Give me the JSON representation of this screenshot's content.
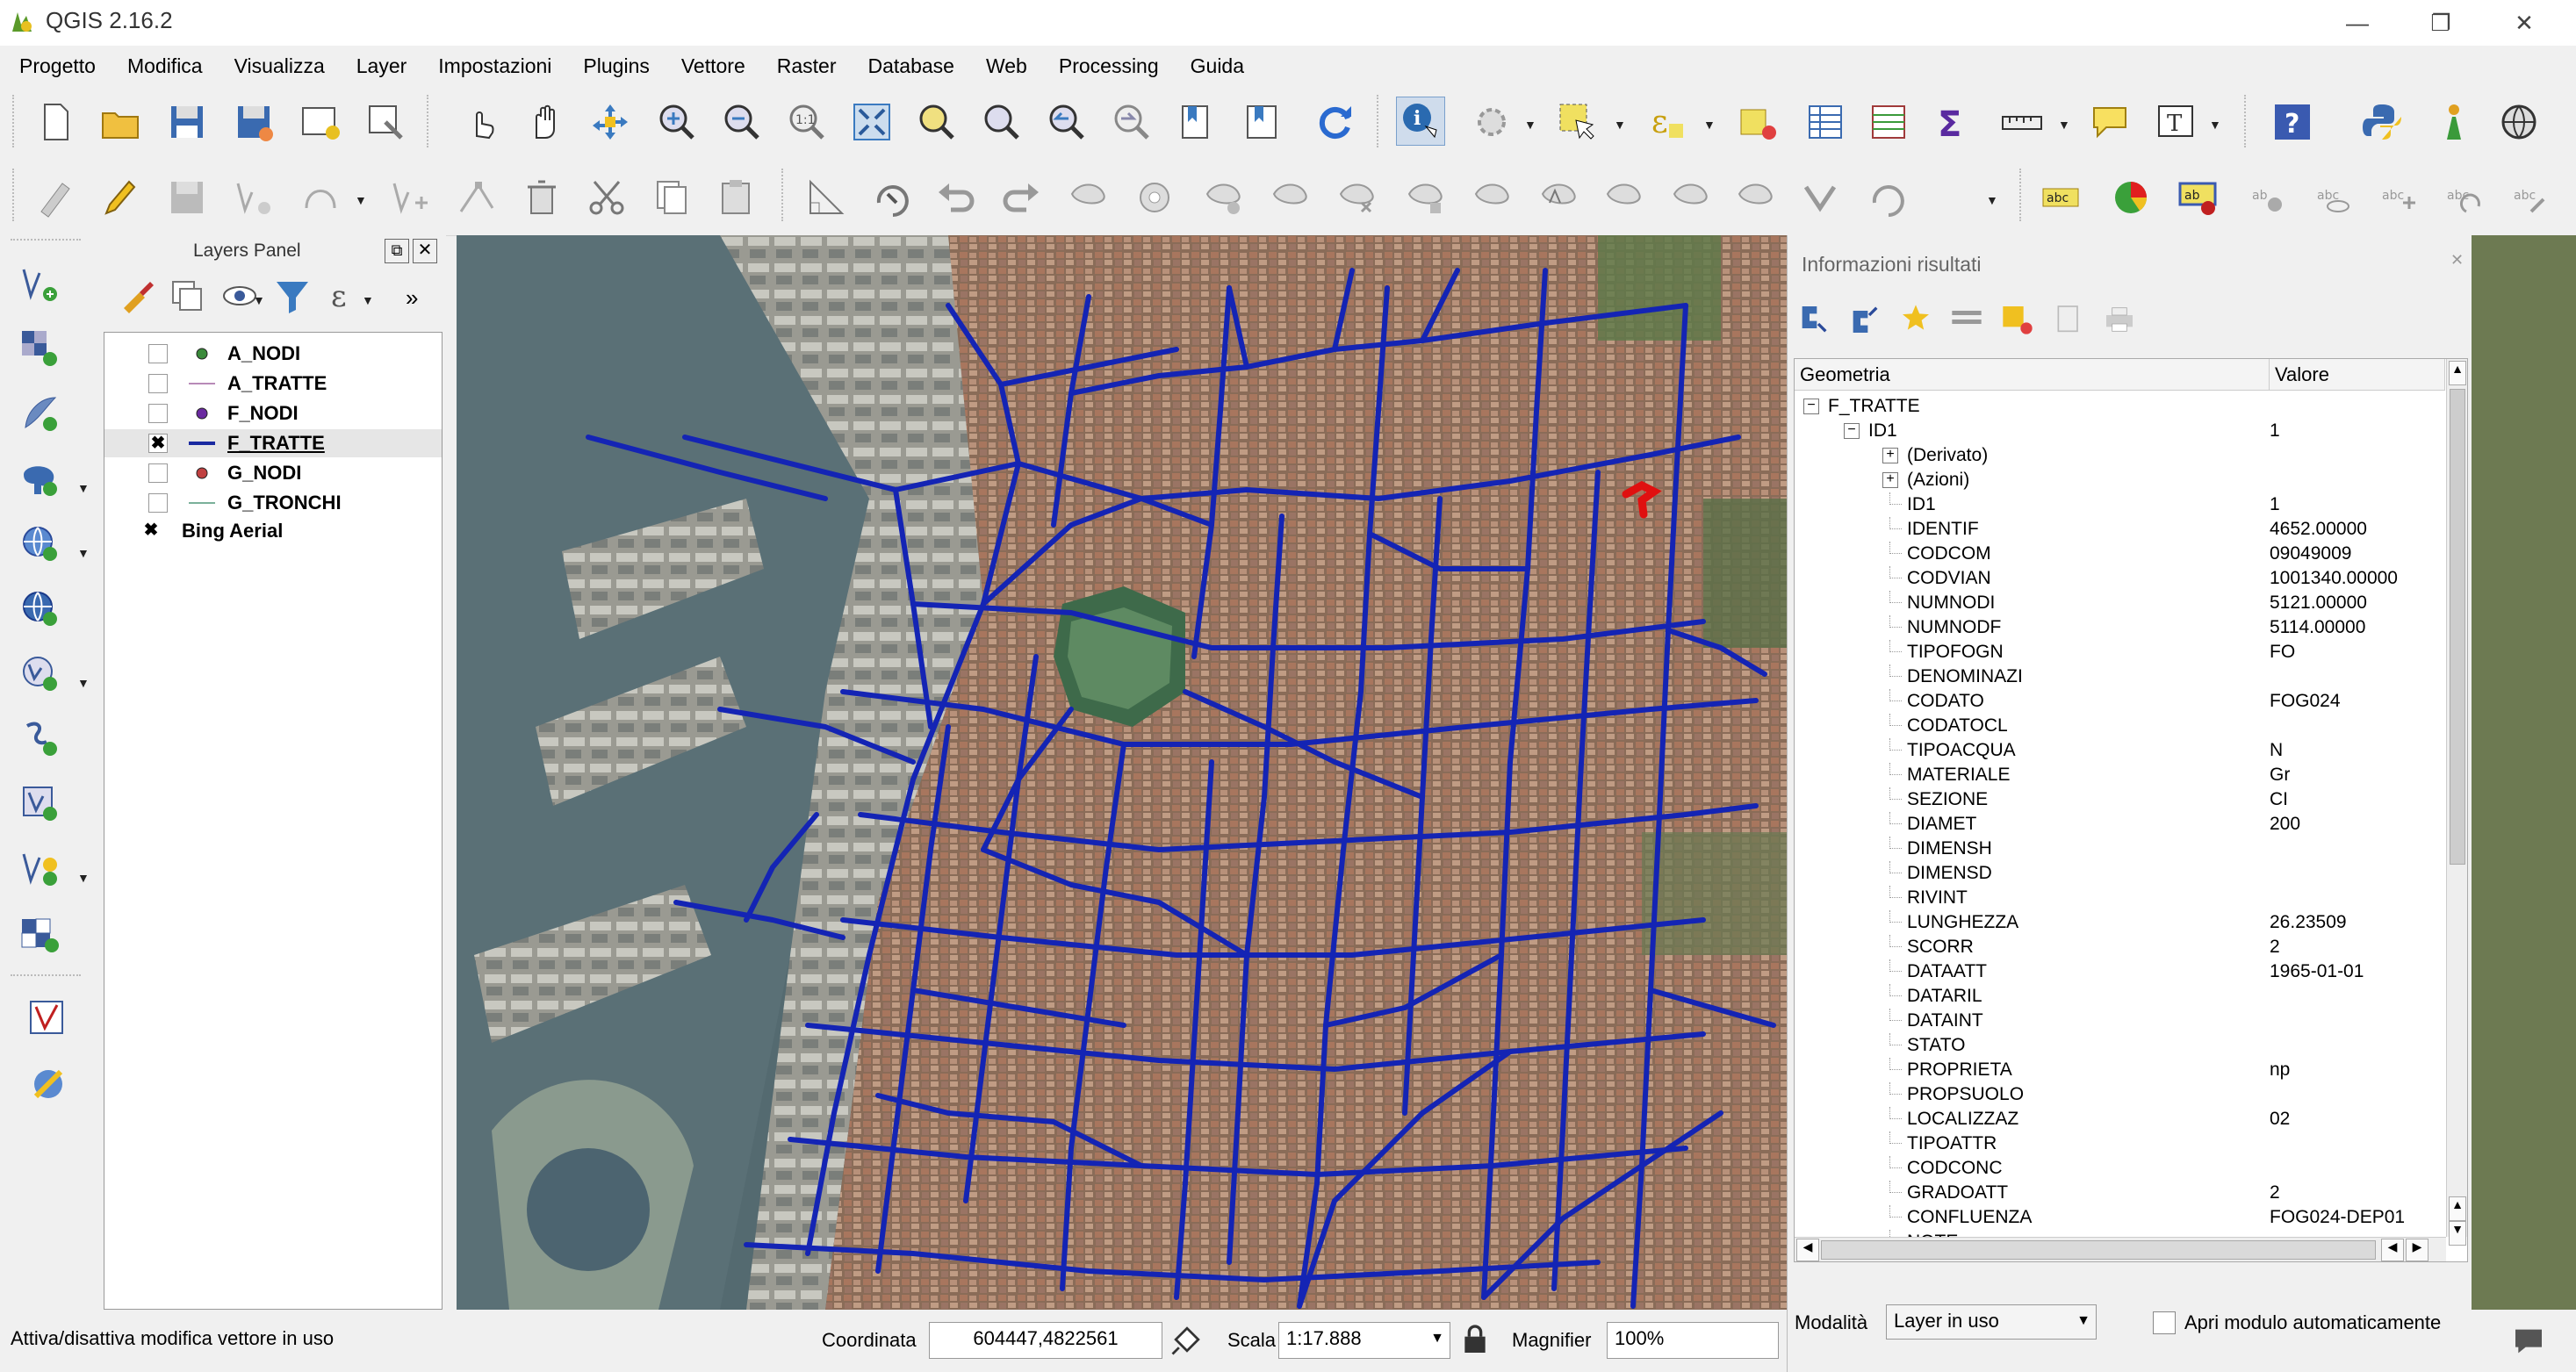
{
  "window": {
    "title": "QGIS 2.16.2",
    "min_icon": "minimize-icon",
    "max_icon": "restore-icon",
    "close_icon": "close-icon"
  },
  "menu": [
    "Progetto",
    "Modifica",
    "Visualizza",
    "Layer",
    "Impostazioni",
    "Plugins",
    "Vettore",
    "Raster",
    "Database",
    "Web",
    "Processing",
    "Guida"
  ],
  "layers_panel": {
    "title": "Layers Panel",
    "layers": [
      {
        "name": "A_NODI",
        "checked": false,
        "symbol": "point",
        "color": "#3a8a3a"
      },
      {
        "name": "A_TRATTE",
        "checked": false,
        "symbol": "line",
        "color": "#b88ab8"
      },
      {
        "name": "F_NODI",
        "checked": false,
        "symbol": "point",
        "color": "#6a2aa0"
      },
      {
        "name": "F_TRATTE",
        "checked": true,
        "symbol": "line",
        "color": "#1a2aa0"
      },
      {
        "name": "G_NODI",
        "checked": false,
        "symbol": "point",
        "color": "#c04040"
      },
      {
        "name": "G_TRONCHI",
        "checked": false,
        "symbol": "line",
        "color": "#7ab09a"
      },
      {
        "name": "Bing Aerial",
        "checked": true,
        "symbol": "none",
        "color": ""
      }
    ]
  },
  "results_panel": {
    "title": "Informazioni risultati",
    "col_geometry": "Geometria",
    "col_value": "Valore",
    "layer": "F_TRATTE",
    "feature_label": "ID1",
    "feature_value": "1",
    "derived": "(Derivato)",
    "actions": "(Azioni)",
    "attributes": [
      {
        "k": "ID1",
        "v": "1"
      },
      {
        "k": "IDENTIF",
        "v": "4652.00000"
      },
      {
        "k": "CODCOM",
        "v": "09049009"
      },
      {
        "k": "CODVIAN",
        "v": "1001340.00000"
      },
      {
        "k": "NUMNODI",
        "v": "5121.00000"
      },
      {
        "k": "NUMNODF",
        "v": "5114.00000"
      },
      {
        "k": "TIPOFOGN",
        "v": "FO"
      },
      {
        "k": "DENOMINAZI",
        "v": ""
      },
      {
        "k": "CODATO",
        "v": "FOG024"
      },
      {
        "k": "CODATOCL",
        "v": ""
      },
      {
        "k": "TIPOACQUA",
        "v": "N"
      },
      {
        "k": "MATERIALE",
        "v": "Gr"
      },
      {
        "k": "SEZIONE",
        "v": "CI"
      },
      {
        "k": "DIAMET",
        "v": "200"
      },
      {
        "k": "DIMENSH",
        "v": ""
      },
      {
        "k": "DIMENSD",
        "v": ""
      },
      {
        "k": "RIVINT",
        "v": ""
      },
      {
        "k": "LUNGHEZZA",
        "v": "26.23509"
      },
      {
        "k": "SCORR",
        "v": "2"
      },
      {
        "k": "DATAATT",
        "v": "1965-01-01"
      },
      {
        "k": "DATARIL",
        "v": ""
      },
      {
        "k": "DATAINT",
        "v": ""
      },
      {
        "k": "STATO",
        "v": ""
      },
      {
        "k": "PROPRIETA",
        "v": "np"
      },
      {
        "k": "PROPSUOLO",
        "v": ""
      },
      {
        "k": "LOCALIZZAZ",
        "v": "02"
      },
      {
        "k": "TIPOATTR",
        "v": ""
      },
      {
        "k": "CODCONC",
        "v": ""
      },
      {
        "k": "GRADOATT",
        "v": "2"
      },
      {
        "k": "CONFLUENZA",
        "v": "FOG024-DEP01"
      },
      {
        "k": "NOTE",
        "v": ""
      }
    ],
    "mode_label": "Modalità",
    "mode_value": "Layer in uso",
    "auto_open_label": "Apri modulo automaticamente"
  },
  "statusbar": {
    "message": "Attiva/disattiva modifica vettore in uso",
    "coord_label": "Coordinata",
    "coord_value": "604447,4822561",
    "scale_label": "Scala",
    "scale_value": "1:17.888",
    "magnifier_label": "Magnifier",
    "magnifier_value": "100%"
  },
  "colors": {
    "network": "#1424b4",
    "selected": "#e01010",
    "accent": "#1a5fb4"
  }
}
